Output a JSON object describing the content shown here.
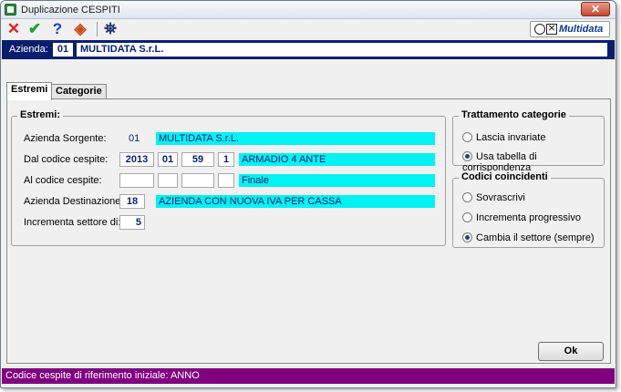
{
  "window": {
    "title": "Duplicazione CESPITI",
    "close_glyph": "✕"
  },
  "toolbar": {
    "buttons": [
      {
        "icon": "cancel-icon",
        "glyph": "✕",
        "color": "#e02020"
      },
      {
        "icon": "confirm-icon",
        "glyph": "✔",
        "color": "#1e9e2e"
      },
      {
        "icon": "help-icon",
        "glyph": "?",
        "color": "#1e3fc8"
      },
      {
        "icon": "tag-icon",
        "glyph": "◈",
        "color": "#d04a1a"
      },
      {
        "icon": "binoculars-icon",
        "glyph": "⛯",
        "color": "#1e2f6e"
      }
    ],
    "brand": {
      "text": "Multidata",
      "box_glyph": "⨯"
    }
  },
  "azienda": {
    "label": "Azienda:",
    "code": "01",
    "name": "MULTIDATA S.r.L."
  },
  "tabs": [
    {
      "label": "Estremi",
      "active": true
    },
    {
      "label": "Categorie",
      "active": false
    }
  ],
  "estremi": {
    "title": "Estremi:",
    "sorgente": {
      "label": "Azienda Sorgente:",
      "code": "01",
      "name": "MULTIDATA S.r.L."
    },
    "dal": {
      "label": "Dal codice cespite:",
      "year": "2013",
      "cat": "01",
      "num": "59",
      "sub": "1",
      "desc": "ARMADIO 4 ANTE"
    },
    "al": {
      "label": "Al codice cespite:",
      "year": "",
      "cat": "",
      "num": "",
      "sub": "",
      "desc": "Finale"
    },
    "destinazione": {
      "label": "Azienda Destinazione:",
      "code": "18",
      "name": "AZIENDA CON NUOVA IVA PER CASSA"
    },
    "incrementa": {
      "label": "Incrementa settore di:",
      "value": "5"
    }
  },
  "trattamento": {
    "title": "Trattamento categorie",
    "options": [
      {
        "label": "Lascia invariate",
        "selected": false
      },
      {
        "label": "Usa tabella di corrispondenza",
        "selected": true
      }
    ]
  },
  "codici": {
    "title": "Codici coincidenti",
    "options": [
      {
        "label": "Sovrascrivi",
        "selected": false
      },
      {
        "label": "Incrementa progressivo",
        "selected": false
      },
      {
        "label": "Cambia il settore (sempre)",
        "selected": true
      }
    ]
  },
  "ok_label": "Ok",
  "status": "Codice cespite di riferimento iniziale: ANNO",
  "colors": {
    "azienda_bar": "#0a1e6e",
    "cyan_field": "#00f2f2",
    "statusbar": "#800080"
  }
}
